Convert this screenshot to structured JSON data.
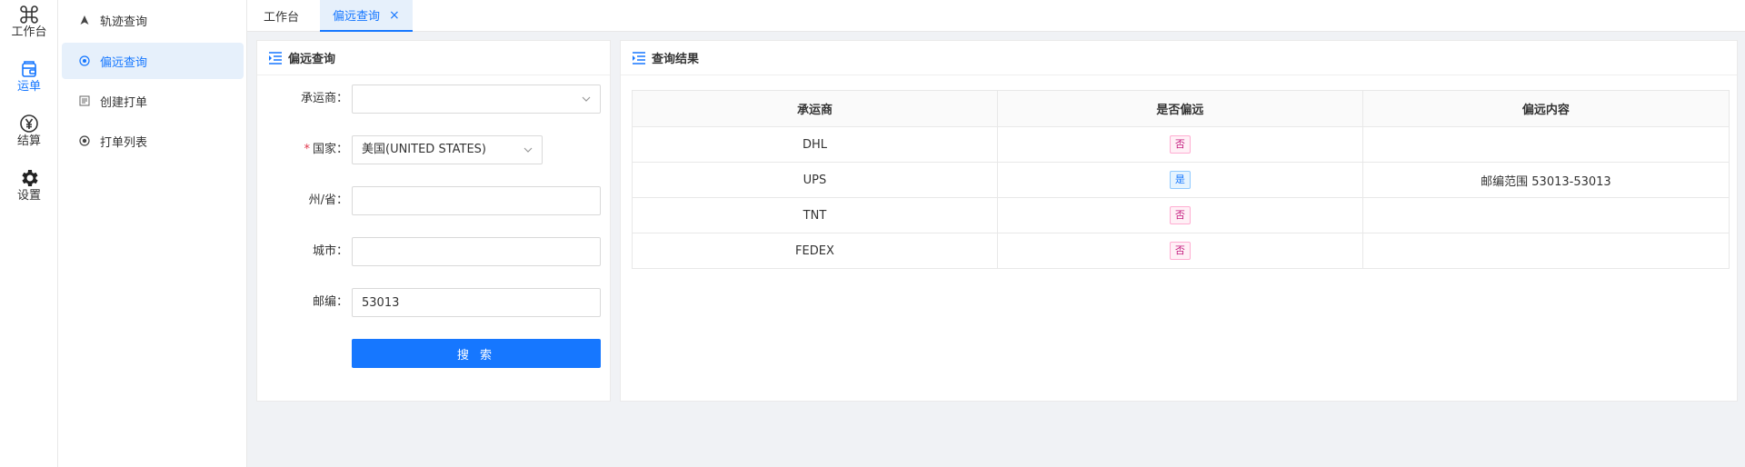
{
  "rail": {
    "items": [
      {
        "label": "工作台",
        "icon": "command-icon"
      },
      {
        "label": "运单",
        "icon": "wallet-icon"
      },
      {
        "label": "结算",
        "icon": "yen-icon"
      },
      {
        "label": "设置",
        "icon": "gear-icon"
      }
    ],
    "active_index": 1
  },
  "submenu": {
    "items": [
      {
        "label": "轨迹查询",
        "icon": "navigation-arrow-icon"
      },
      {
        "label": "偏远查询",
        "icon": "target-icon"
      },
      {
        "label": "创建打单",
        "icon": "form-icon"
      },
      {
        "label": "打单列表",
        "icon": "list-circle-icon"
      }
    ],
    "active_index": 1
  },
  "tabs": [
    {
      "label": "工作台"
    },
    {
      "label": "偏远查询",
      "active": true,
      "close": "×"
    }
  ],
  "query_panel": {
    "title": "偏远查询",
    "carrier_label": "承运商：",
    "carrier_value": "",
    "required_mark": "*",
    "country_label": "国家：",
    "country_value": "美国(UNITED STATES)",
    "state_label": "州/省：",
    "state_value": "",
    "city_label": "城市：",
    "city_value": "",
    "zip_label": "邮编：",
    "zip_value": "53013",
    "search_button": "搜 索"
  },
  "result_panel": {
    "title": "查询结果",
    "columns": [
      "承运商",
      "是否偏远",
      "偏远内容"
    ],
    "rows": [
      {
        "carrier": "DHL",
        "remote": "否",
        "is_remote": false,
        "content": ""
      },
      {
        "carrier": "UPS",
        "remote": "是",
        "is_remote": true,
        "content": "邮编范围 53013-53013"
      },
      {
        "carrier": "TNT",
        "remote": "否",
        "is_remote": false,
        "content": ""
      },
      {
        "carrier": "FEDEX",
        "remote": "否",
        "is_remote": false,
        "content": ""
      }
    ]
  },
  "colors": {
    "accent": "#1677ff",
    "active_bg": "#e6f0fb",
    "required": "#e0364b",
    "badge_no": "#c41d7f",
    "badge_yes": "#1677ff"
  }
}
